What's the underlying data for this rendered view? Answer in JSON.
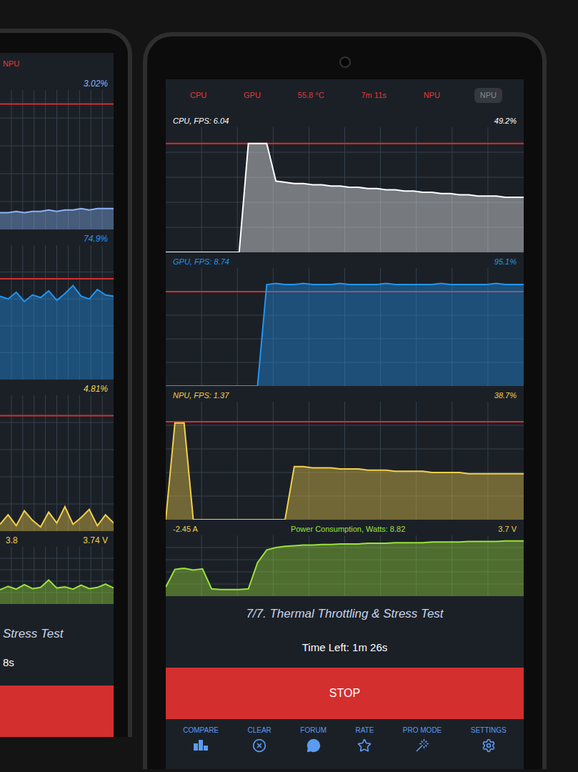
{
  "left_phone": {
    "status": {
      "label": "NPU",
      "color": "#e53935"
    },
    "charts": [
      {
        "name": "cpu",
        "reading": "3.02%",
        "color": "#8ab4f8",
        "limit": 0.9,
        "values": [
          12,
          12,
          13,
          12,
          13,
          13,
          14,
          13,
          14,
          14,
          15,
          14,
          15,
          15,
          15
        ]
      },
      {
        "name": "gpu",
        "reading": "74.9%",
        "color": "#2196f3",
        "limit": 0.75,
        "values": [
          62,
          60,
          65,
          58,
          63,
          61,
          66,
          59,
          64,
          70,
          62,
          60,
          67,
          63,
          62
        ]
      },
      {
        "name": "npu",
        "reading": "4.81%",
        "color": "#f2d04b",
        "limit": 0.85,
        "values": [
          5,
          12,
          4,
          15,
          8,
          3,
          14,
          6,
          18,
          5,
          10,
          16,
          4,
          12,
          6
        ]
      }
    ],
    "power": {
      "current": "3.8",
      "voltage": "3.74 V",
      "color": "#9be23c",
      "values": [
        2.5,
        3.1,
        2.6,
        3.4,
        2.7,
        2.9,
        4.2,
        2.8,
        3.0,
        2.6,
        3.3,
        2.7,
        2.9,
        3.5,
        2.8
      ]
    },
    "test": "Stress Test",
    "time_left": "8s"
  },
  "right_phone": {
    "status_bar": [
      {
        "label": "CPU",
        "color": "#e53935",
        "selected": false
      },
      {
        "label": "GPU",
        "color": "#e53935",
        "selected": false
      },
      {
        "label": "55.8 °C",
        "color": "#e53935",
        "selected": false
      },
      {
        "label": "7m 11s",
        "color": "#e53935",
        "selected": false
      },
      {
        "label": "NPU",
        "color": "#e53935",
        "selected": false
      },
      {
        "label": "NPU",
        "color": "#8a8a8a",
        "selected": true
      }
    ],
    "charts": [
      {
        "name": "cpu",
        "title": "CPU, FPS: 6.04",
        "reading": "49.2%",
        "color": "#ffffff",
        "limit": 0.87,
        "values": [
          0,
          0,
          0,
          0,
          0,
          0,
          0,
          0,
          0,
          87,
          87,
          87,
          57,
          56,
          55,
          55,
          54,
          54,
          53,
          53,
          52,
          52,
          51,
          51,
          50,
          50,
          49,
          49,
          48,
          48,
          47,
          47,
          46,
          46,
          45,
          45,
          45,
          44,
          44,
          44
        ]
      },
      {
        "name": "gpu",
        "title": "GPU, FPS: 8.74",
        "reading": "95.1%",
        "color": "#2196f3",
        "limit": 0.8,
        "values": [
          0,
          0,
          0,
          0,
          0,
          0,
          0,
          0,
          0,
          0,
          0,
          86,
          87,
          86,
          86,
          87,
          86,
          86,
          86,
          87,
          86,
          86,
          86,
          86,
          87,
          86,
          86,
          86,
          86,
          86,
          87,
          86,
          86,
          86,
          86,
          86,
          87,
          86,
          86,
          86
        ]
      },
      {
        "name": "npu",
        "title": "NPU, FPS: 1.37",
        "reading": "38.7%",
        "color": "#f2d04b",
        "limit": 0.83,
        "values": [
          0,
          82,
          82,
          0,
          0,
          0,
          0,
          0,
          0,
          0,
          0,
          0,
          0,
          0,
          45,
          45,
          44,
          44,
          44,
          43,
          43,
          43,
          42,
          42,
          42,
          41,
          41,
          41,
          41,
          40,
          40,
          40,
          40,
          39,
          39,
          39,
          39,
          39,
          39,
          39
        ]
      }
    ],
    "power": {
      "current": "-2.45 A",
      "title": "Power Consumption, Watts: 8.82",
      "voltage": "3.7 V",
      "color": "#9be23c",
      "values": [
        1.5,
        4.4,
        4.6,
        4.3,
        4.5,
        1.2,
        1.1,
        1.1,
        1.1,
        1.2,
        5.5,
        7.6,
        8.0,
        8.2,
        8.3,
        8.4,
        8.4,
        8.5,
        8.5,
        8.6,
        8.6,
        8.6,
        8.7,
        8.7,
        8.7,
        8.8,
        8.8,
        8.8,
        8.8,
        8.9,
        8.9,
        8.9,
        8.9,
        9.0,
        9.0,
        9.0,
        9.0,
        9.1,
        9.1,
        9.1
      ]
    },
    "test": {
      "step": "7/7. Thermal Throttling & Stress Test",
      "time_left": "Time Left: 1m 26s"
    },
    "stop_button": "STOP",
    "nav": [
      {
        "label": "COMPARE"
      },
      {
        "label": "CLEAR"
      },
      {
        "label": "FORUM"
      },
      {
        "label": "RATE"
      },
      {
        "label": "PRO MODE"
      },
      {
        "label": "SETTINGS"
      }
    ]
  }
}
